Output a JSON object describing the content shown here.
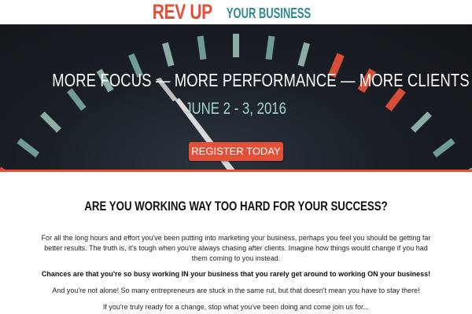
{
  "colors": {
    "accent": "#e2503a",
    "teal": "#2e8a8e",
    "date": "#9fd8cc",
    "button": "#e2503a"
  },
  "header": {
    "logo_main": "REV UP",
    "logo_sub": "YOUR BUSINESS"
  },
  "hero": {
    "headline": "MORE FOCUS — MORE PERFORMANCE — MORE CLIENTS",
    "date": "JUNE 2 - 3, 2016",
    "register_label": "REGISTER TODAY"
  },
  "main": {
    "title": "ARE YOU WORKING WAY TOO HARD FOR YOUR SUCCESS?",
    "paragraphs": [
      "For all the long hours and effort you've been putting into marketing your business,  perhaps you feel you should be getting far better results.  The truth is, it's tough when you're always chasing after clients.  Imagine how things would change if you had them coming to you instead.",
      "Chances are that you're so busy working IN your business that you rarely get around to working ON your business!",
      "And you're not alone! So many entrepreneurs are stuck in the same rut, but that doesn't mean you have to stay there!",
      "If you're truly ready for a change, stop what you've been doing and come join us for..."
    ]
  }
}
